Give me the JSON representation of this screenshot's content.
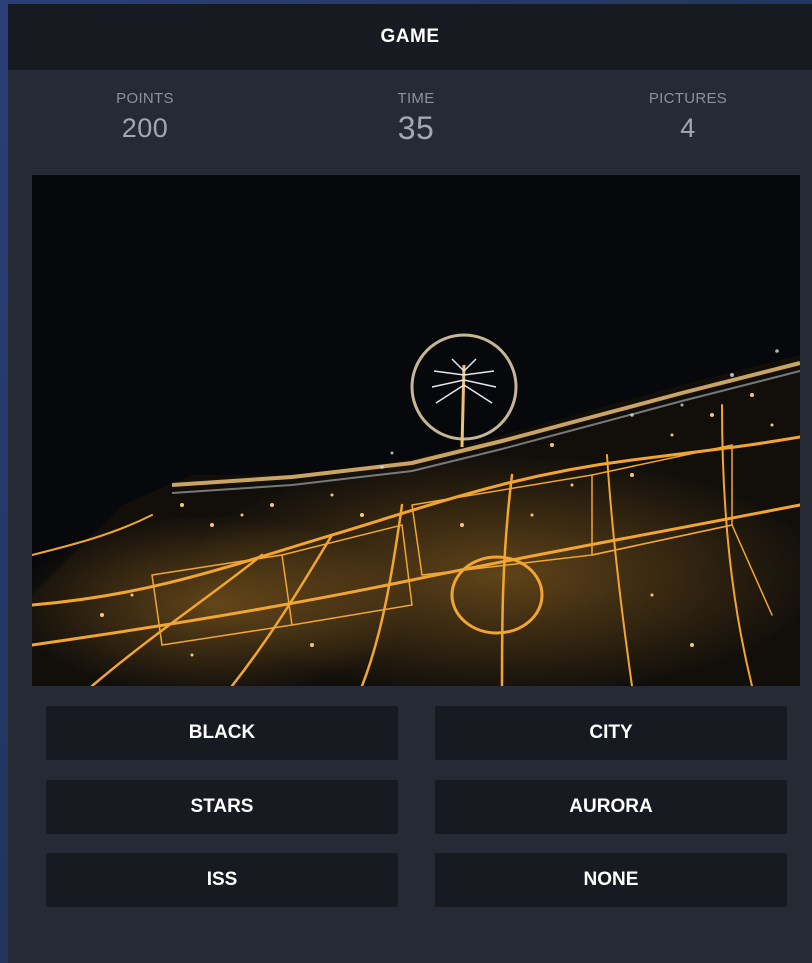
{
  "header": {
    "title": "GAME"
  },
  "stats": {
    "points_label": "POINTS",
    "points_value": "200",
    "time_label": "TIME",
    "time_value": "35",
    "pictures_label": "PICTURES",
    "pictures_value": "4"
  },
  "answers": [
    "BLACK",
    "CITY",
    "STARS",
    "AURORA",
    "ISS",
    "NONE"
  ],
  "colors": {
    "panel": "#262a35",
    "header": "#181a22",
    "button": "#181a22",
    "city_lights": "#f2a531",
    "background": "#22355f"
  }
}
